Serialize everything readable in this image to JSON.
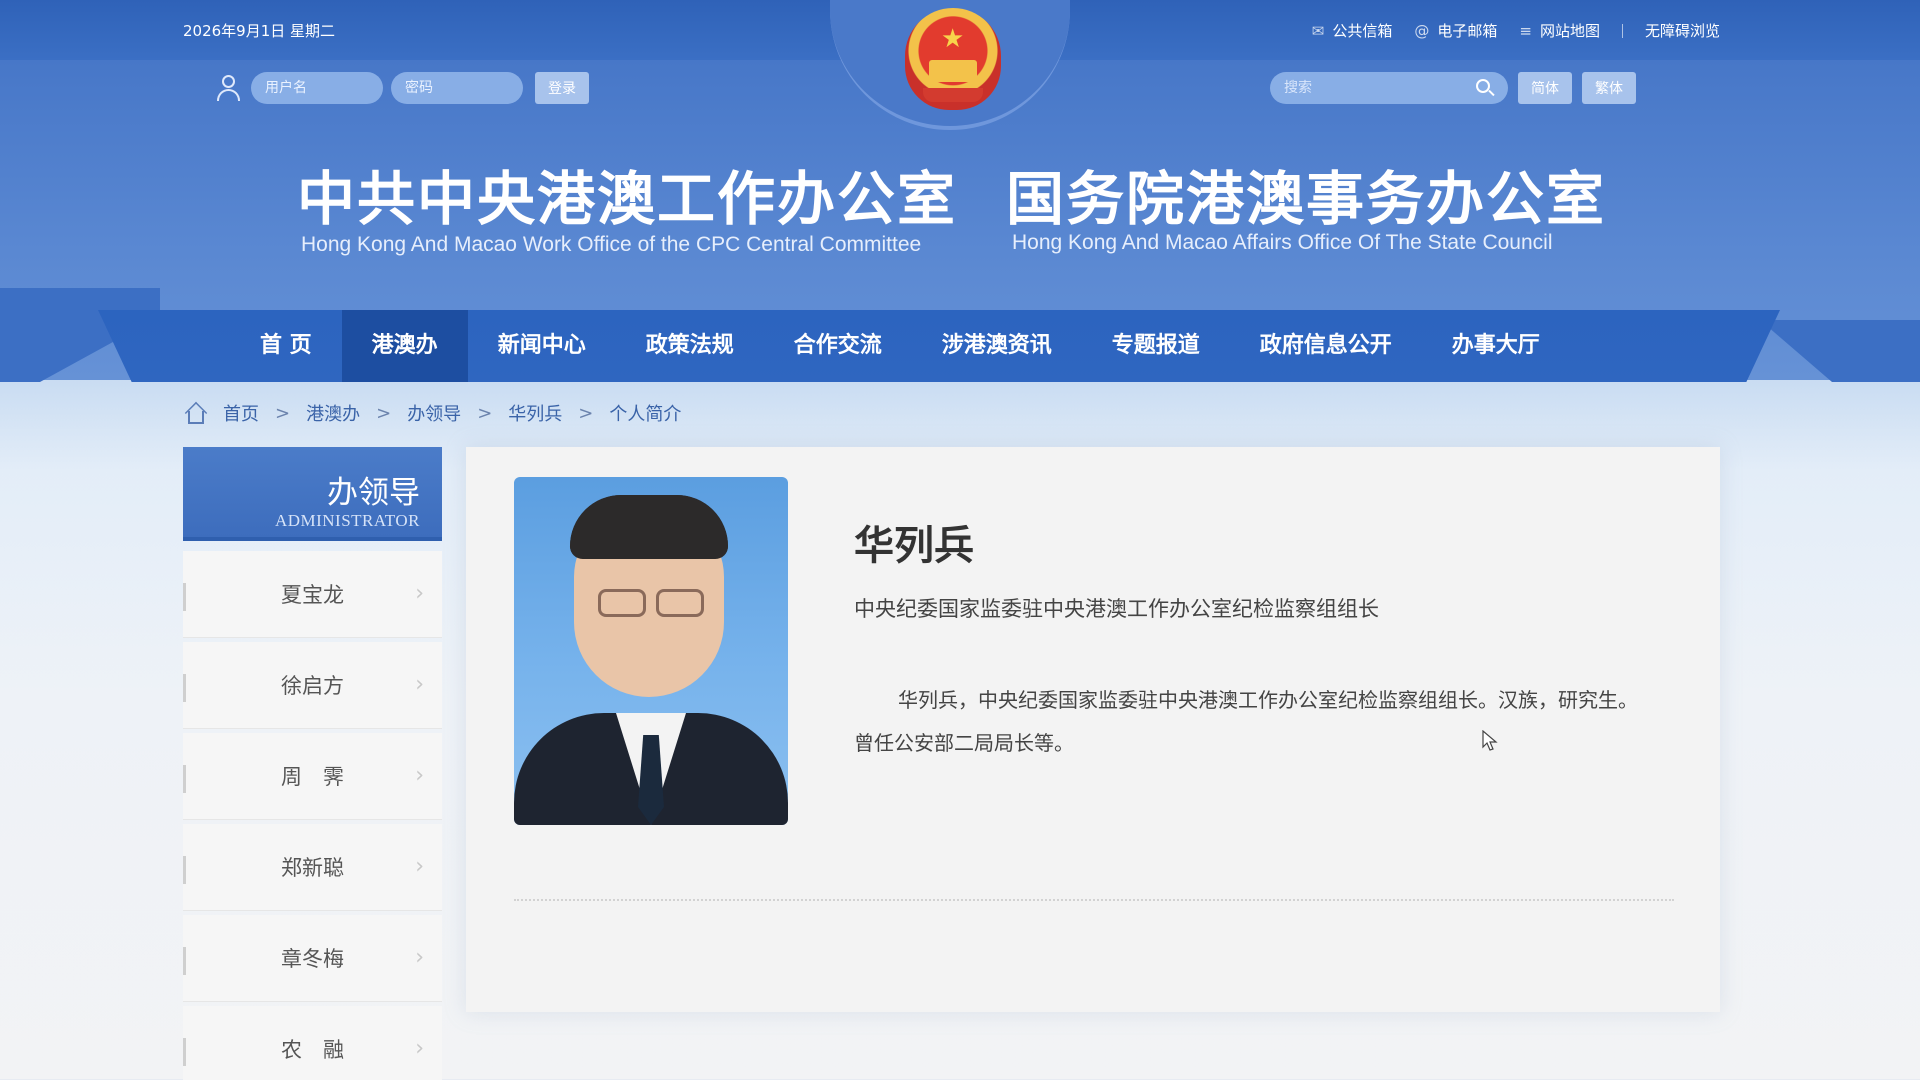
{
  "header": {
    "date": "2026年9月1日 星期二",
    "top_links": [
      {
        "icon": "mail-icon",
        "glyph": "✉",
        "label": "公共信箱"
      },
      {
        "icon": "at-icon",
        "glyph": "@",
        "label": "电子邮箱"
      },
      {
        "icon": "list-icon",
        "glyph": "≡",
        "label": "网站地图"
      },
      {
        "icon": "",
        "glyph": "",
        "label": "无障碍浏览"
      }
    ],
    "login": {
      "username_placeholder": "用户名",
      "password_placeholder": "密码",
      "login_label": "登录"
    },
    "search": {
      "placeholder": "搜索",
      "simplified_label": "简体",
      "traditional_label": "繁体"
    },
    "title_left_cn": "中共中央港澳工作办公室",
    "title_left_en": "Hong Kong And Macao Work Office of the CPC Central Committee",
    "title_right_cn": "国务院港澳事务办公室",
    "title_right_en": "Hong Kong And Macao Affairs Office Of The State Council",
    "colors": {
      "primary": "#2f66c0",
      "active_nav": "#1d4ea1",
      "header": "#5a86d0"
    }
  },
  "nav": {
    "items": [
      "首 页",
      "港澳办",
      "新闻中心",
      "政策法规",
      "合作交流",
      "涉港澳资讯",
      "专题报道",
      "政府信息公开",
      "办事大厅"
    ],
    "active_index": 1
  },
  "breadcrumb": {
    "items": [
      "首页",
      "港澳办",
      "办领导",
      "华列兵",
      "个人简介"
    ],
    "separator": ">"
  },
  "sidebar": {
    "title_cn": "办领导",
    "title_en": "ADMINISTRATOR",
    "items": [
      "夏宝龙",
      "徐启方",
      "周　霁",
      "郑新聪",
      "章冬梅",
      "农　融"
    ]
  },
  "profile": {
    "name": "华列兵",
    "position": "中央纪委国家监委驻中央港澳工作办公室纪检监察组组长",
    "bio": "华列兵，中央纪委国家监委驻中央港澳工作办公室纪检监察组组长。汉族，研究生。曾任公安部二局局长等。"
  }
}
